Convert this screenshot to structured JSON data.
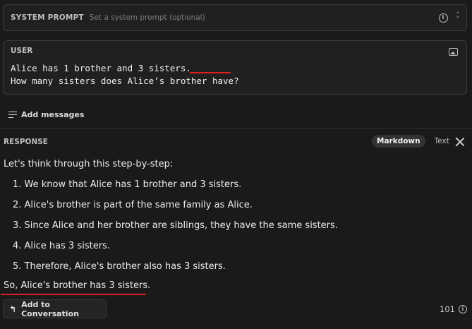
{
  "system": {
    "label": "SYSTEM PROMPT",
    "placeholder": "Set a system prompt (optional)",
    "info_icon": "info-icon",
    "toggle_icon": "chevron-up-down-icon"
  },
  "user": {
    "label": "USER",
    "line1": "Alice has 1 brother and 3 sisters.",
    "line2": "How many sisters does Alice’s brother have?",
    "image_icon": "image-icon",
    "highlight_color": "#e0201f"
  },
  "add_messages": {
    "label": "Add messages",
    "icon": "list-plus-icon"
  },
  "response": {
    "label": "RESPONSE",
    "tabs": [
      {
        "label": "Markdown",
        "active": true
      },
      {
        "label": "Text",
        "active": false
      }
    ],
    "intro": "Let's think through this step-by-step:",
    "steps": [
      "1. We know that Alice has 1 brother and 3 sisters.",
      "2. Alice's brother is part of the same family as Alice.",
      "3. Since Alice and her brother are siblings, they have the same sisters.",
      "4. Alice has 3 sisters.",
      "5. Therefore, Alice's brother also has 3 sisters."
    ],
    "conclusion": "So, Alice's brother has 3 sisters.",
    "add_to_conversation": "Add to Conversation",
    "token_count": "101"
  }
}
